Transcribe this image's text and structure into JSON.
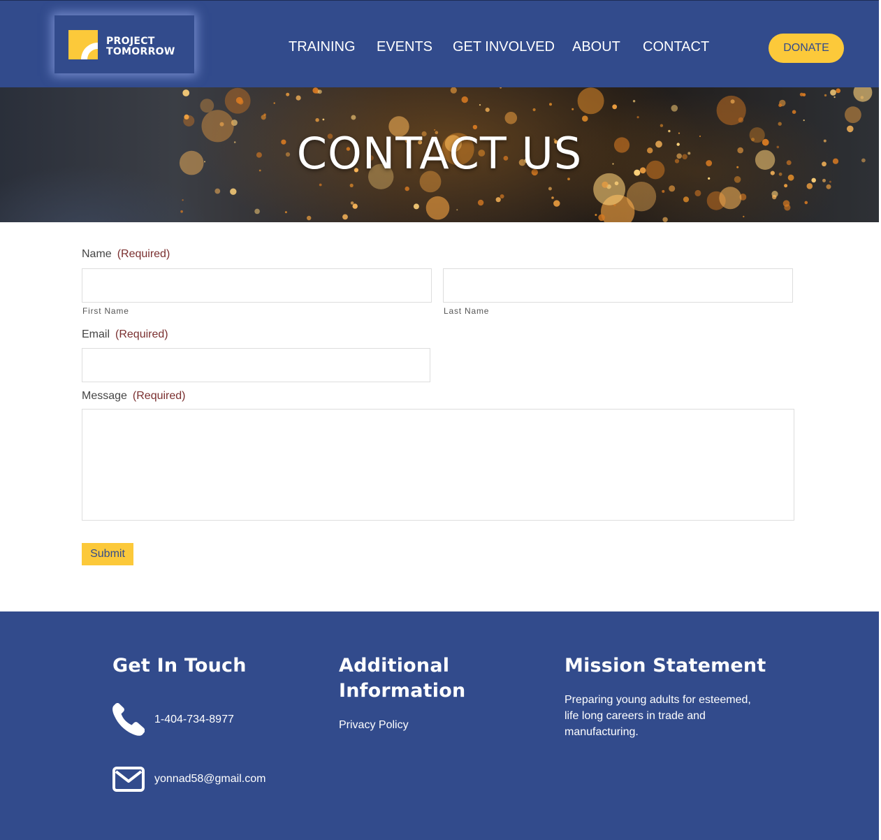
{
  "header": {
    "logo": {
      "line1": "PROJECT",
      "line2": "TOMORROW"
    },
    "nav": [
      {
        "label": "TRAINING"
      },
      {
        "label": "EVENTS"
      },
      {
        "label": "GET INVOLVED"
      },
      {
        "label": "ABOUT"
      },
      {
        "label": "CONTACT"
      }
    ],
    "donate_label": "DONATE"
  },
  "hero": {
    "title": "CONTACT US"
  },
  "form": {
    "name": {
      "label": "Name",
      "required": "(Required)",
      "first_label": "First Name",
      "last_label": "Last Name",
      "first_value": "",
      "last_value": ""
    },
    "email": {
      "label": "Email",
      "required": "(Required)",
      "value": ""
    },
    "message": {
      "label": "Message",
      "required": "(Required)",
      "value": ""
    },
    "submit_label": "Submit"
  },
  "footer": {
    "get_in_touch": {
      "heading": "Get In Touch",
      "phone": "1-404-734-8977",
      "email": "yonnad58@gmail.com",
      "phone_icon": "phone-icon",
      "email_icon": "envelope-icon"
    },
    "additional": {
      "heading_line1": "Additional",
      "heading_line2": "Information",
      "privacy_link": "Privacy Policy"
    },
    "mission": {
      "heading": "Mission Statement",
      "line1": "Preparing young adults for esteemed,",
      "line2": "life long careers in trade and",
      "line3": "manufacturing."
    }
  },
  "colors": {
    "brand_blue": "#324b8c",
    "accent_yellow": "#fcc93a",
    "required_red": "#7a2f2f"
  }
}
